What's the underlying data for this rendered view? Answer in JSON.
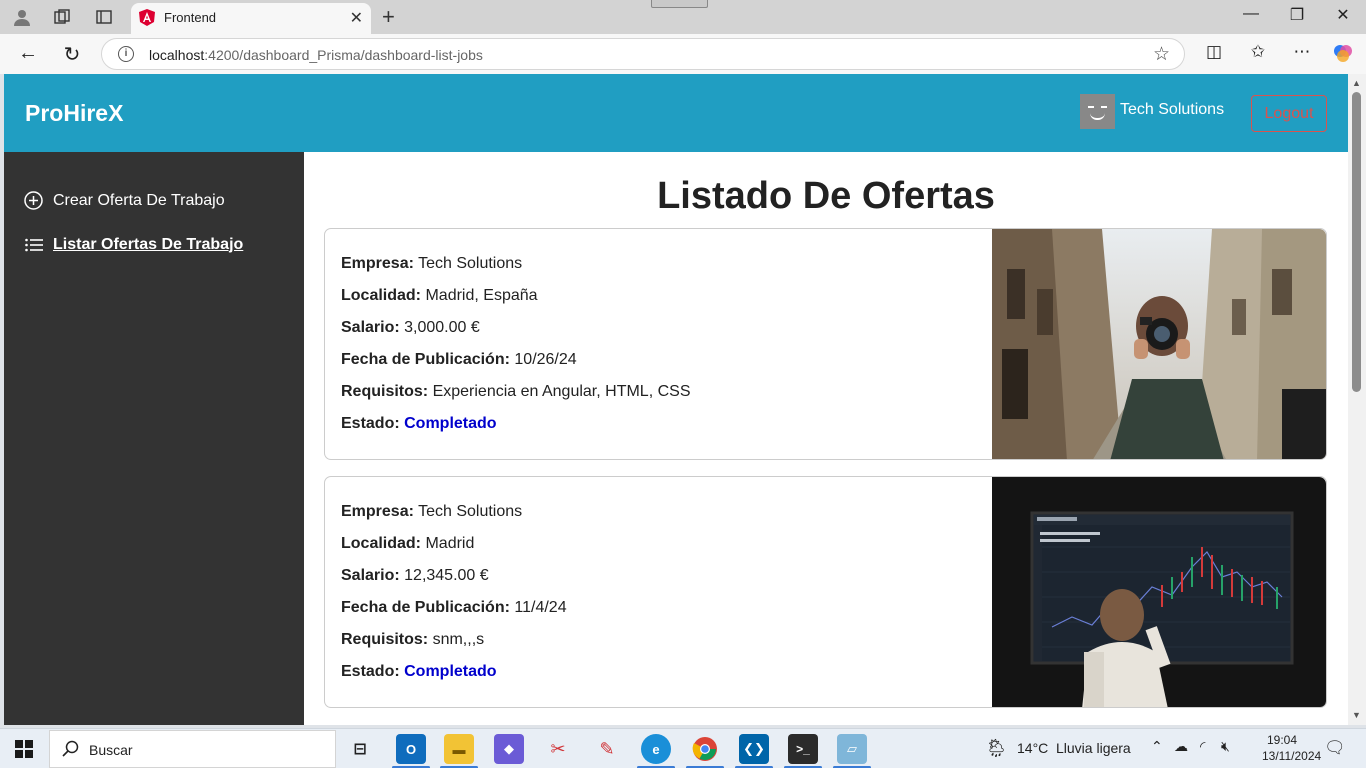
{
  "browser": {
    "tab_title": "Frontend",
    "url_host": "localhost",
    "url_path": ":4200/dashboard_Prisma/dashboard-list-jobs"
  },
  "app": {
    "brand": "ProHireX",
    "company_name": "Tech Solutions",
    "logout_label": "Logout",
    "sidebar": {
      "items": [
        {
          "label": "Crear Oferta De Trabajo",
          "icon": "plus-circle-icon"
        },
        {
          "label": "Listar Ofertas De Trabajo",
          "icon": "list-icon",
          "active": true
        }
      ]
    },
    "page_title": "Listado De Ofertas",
    "field_labels": {
      "empresa": "Empresa:",
      "localidad": "Localidad:",
      "salario": "Salario:",
      "fecha": "Fecha de Publicación:",
      "requisitos": "Requisitos:",
      "estado": "Estado:"
    },
    "jobs": [
      {
        "empresa": "Tech Solutions",
        "localidad": "Madrid, España",
        "salario": "3,000.00 €",
        "fecha": "10/26/24",
        "requisitos": "Experiencia en Angular, HTML, CSS",
        "estado": "Completado",
        "image": "photographer-street-photo"
      },
      {
        "empresa": "Tech Solutions",
        "localidad": "Madrid",
        "salario": "12,345.00 €",
        "fecha": "11/4/24",
        "requisitos": "snm,,,s",
        "estado": "Completado",
        "image": "trader-chart-screen-photo"
      }
    ],
    "status_color": "#0000cc",
    "header_color": "#209ec2",
    "sidebar_color": "#333333"
  },
  "taskbar": {
    "search_placeholder": "Buscar",
    "weather_temp": "14°C",
    "weather_desc": "Lluvia ligera",
    "time": "19:04",
    "date": "13/11/2024"
  }
}
